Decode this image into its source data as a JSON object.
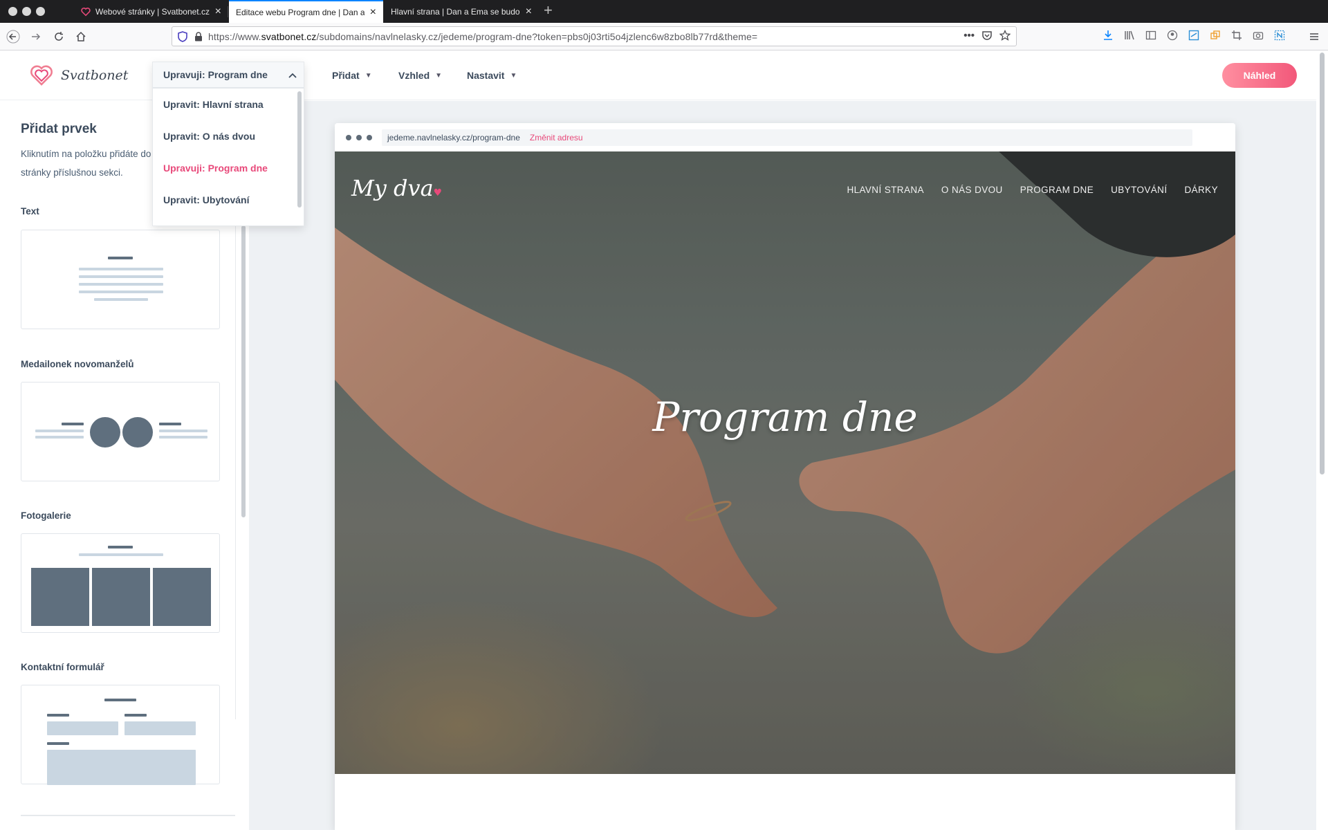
{
  "browser": {
    "tabs": [
      {
        "title": "Webové stránky | Svatbonet.cz"
      },
      {
        "title": "Editace webu Program dne | Dan a Ema"
      },
      {
        "title": "Hlavní strana | Dan a Ema se budou brát"
      }
    ],
    "url_prefix": "https://www.",
    "url_domain": "svatbonet.cz",
    "url_rest": "/subdomains/navlnelasky.cz/jedeme/program-dne?token=pbs0j03rti5o4jzlenc6w8zbo8lb77rd&theme="
  },
  "header": {
    "logo": "Svatbonet",
    "current_page": "Upravuji: Program dne",
    "menu": [
      "Přidat",
      "Vzhled",
      "Nastavit"
    ],
    "preview_label": "Náhled"
  },
  "dropdown": {
    "items": [
      {
        "label": "Upravit: Hlavní strana",
        "active": false
      },
      {
        "label": "Upravit: O nás dvou",
        "active": false
      },
      {
        "label": "Upravuji: Program dne",
        "active": true
      },
      {
        "label": "Upravit: Ubytování",
        "active": false
      }
    ]
  },
  "sidebar": {
    "title": "Přidat prvek",
    "description": "Kliknutím na položku přidáte do stránky příslušnou sekci.",
    "sections": [
      "Text",
      "Medailonek novomanželů",
      "Fotogalerie",
      "Kontaktní formulář"
    ]
  },
  "preview": {
    "address": "jedeme.navlnelasky.cz/program-dne",
    "change_address": "Změnit adresu",
    "site_logo": "My dva",
    "nav": [
      "HLAVNÍ STRANA",
      "O NÁS DVOU",
      "PROGRAM DNE",
      "UBYTOVÁNÍ",
      "DÁRKY"
    ],
    "hero_title": "Program dne"
  },
  "colors": {
    "accent": "#e8497a",
    "text": "#3b4a5c",
    "placeholder_dark": "#5f6f7e",
    "placeholder_light": "#c9d6e1"
  }
}
